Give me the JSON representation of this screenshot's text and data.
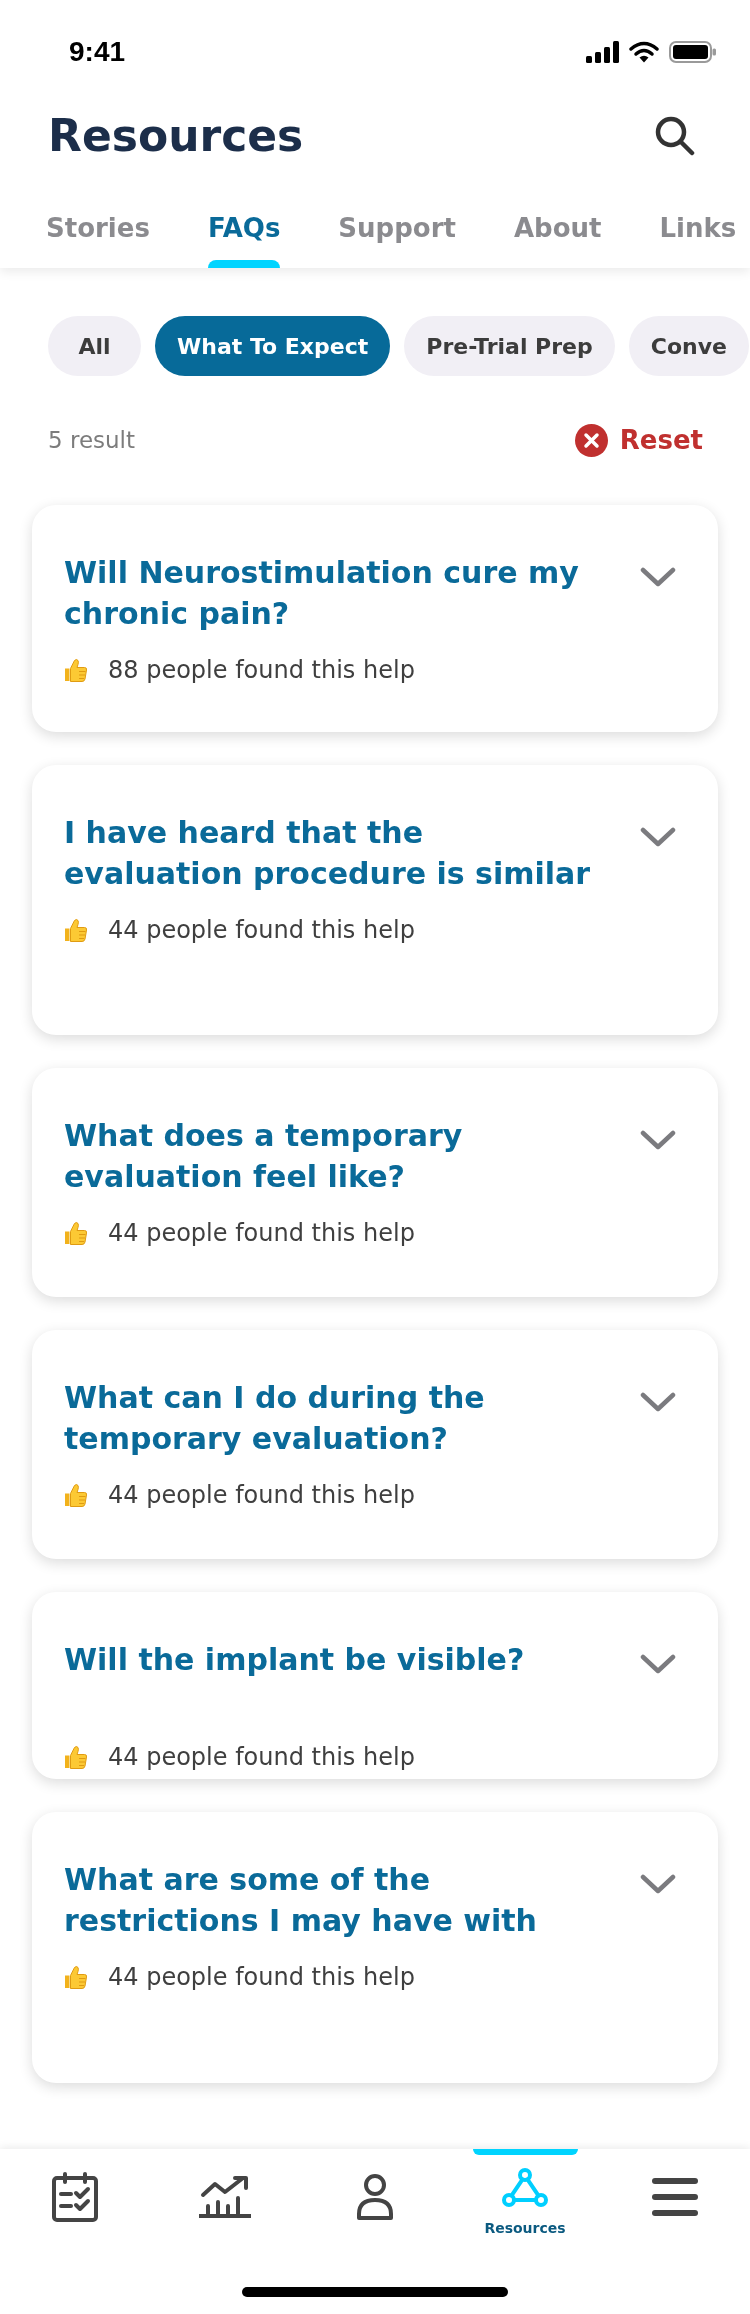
{
  "status_bar": {
    "time": "9:41"
  },
  "header": {
    "title": "Resources"
  },
  "tabs": [
    {
      "label": "Stories",
      "selected": false
    },
    {
      "label": "FAQs",
      "selected": true
    },
    {
      "label": "Support",
      "selected": false
    },
    {
      "label": "About",
      "selected": false
    },
    {
      "label": "Links",
      "selected": false
    }
  ],
  "filters": [
    {
      "label": "All",
      "selected": false
    },
    {
      "label": "What To Expect",
      "selected": true
    },
    {
      "label": "Pre-Trial Prep",
      "selected": false
    },
    {
      "label": "Conve",
      "selected": false
    }
  ],
  "results": {
    "count": "5 result",
    "reset": "Reset"
  },
  "faqs": [
    {
      "question": "Will Neurostimulation cure my chronic pain?",
      "helpful": "88 people found this help",
      "expanded": false
    },
    {
      "question": "I have heard that the evaluation procedure is similar",
      "helpful": "44 people found this help",
      "expanded": false
    },
    {
      "question": "What does a temporary evaluation feel like?",
      "helpful": "44 people found this help",
      "expanded": false
    },
    {
      "question": "What can I do during the temporary evaluation?",
      "helpful": "44 people found this help",
      "expanded": false
    },
    {
      "question": "Will the implant be visible?",
      "helpful": "44 people found this help",
      "expanded": false
    },
    {
      "question": "What are some of the restrictions I may have with",
      "helpful": "44 people found this help",
      "expanded": false
    }
  ],
  "bottom_nav": [
    {
      "selected": false
    },
    {
      "selected": false
    },
    {
      "selected": false
    },
    {
      "label": "Resources",
      "selected": true
    },
    {
      "selected": false
    }
  ]
}
